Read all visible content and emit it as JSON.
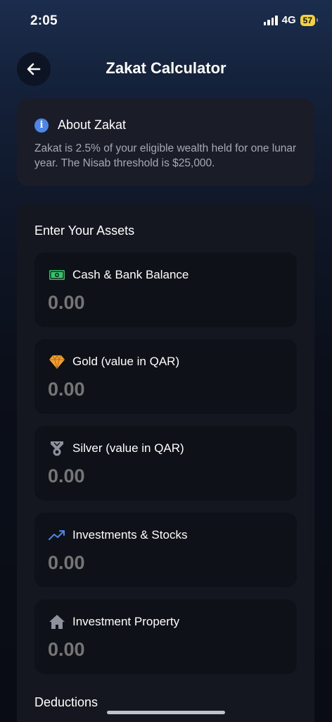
{
  "status_bar": {
    "time": "2:05",
    "network": "4G",
    "battery": "57"
  },
  "header": {
    "title": "Zakat Calculator",
    "back_icon": "arrow-left-icon"
  },
  "about": {
    "icon": "info-icon",
    "title": "About Zakat",
    "text": "Zakat is 2.5% of your eligible wealth held for one lunar year. The Nisab threshold is $25,000."
  },
  "assets": {
    "title": "Enter Your Assets",
    "fields": [
      {
        "label": "Cash & Bank Balance",
        "placeholder": "0.00",
        "icon": "money-icon",
        "icon_color": "#35c46a"
      },
      {
        "label": "Gold (value in QAR)",
        "placeholder": "0.00",
        "icon": "diamond-icon",
        "icon_color": "#f0a132"
      },
      {
        "label": "Silver (value in QAR)",
        "placeholder": "0.00",
        "icon": "medal-icon",
        "icon_color": "#8e929c"
      },
      {
        "label": "Investments & Stocks",
        "placeholder": "0.00",
        "icon": "trending-up-icon",
        "icon_color": "#4e86e8"
      },
      {
        "label": "Investment Property",
        "placeholder": "0.00",
        "icon": "house-icon",
        "icon_color": "#8e929c"
      }
    ]
  },
  "deductions": {
    "title": "Deductions"
  }
}
